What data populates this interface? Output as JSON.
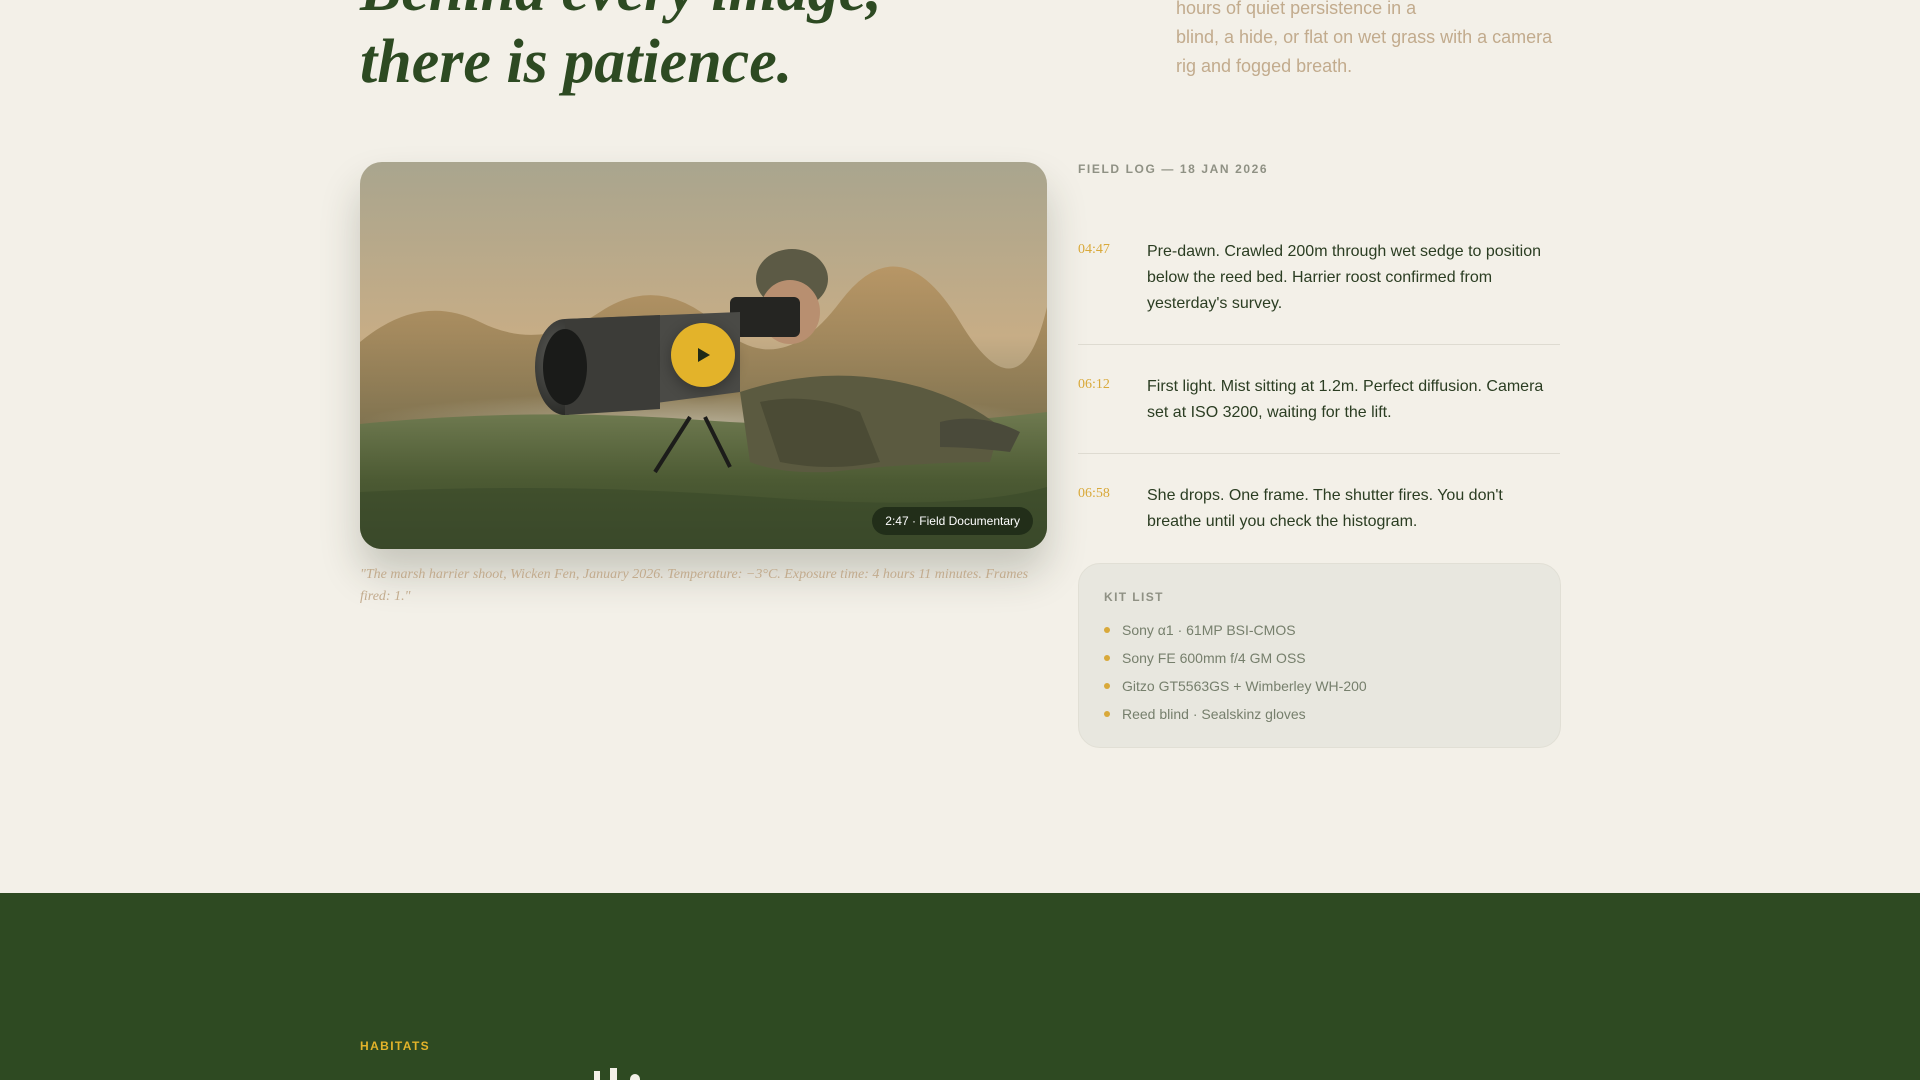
{
  "hero": {
    "heading_line1": "Behind every image,",
    "heading_line2": "there is patience.",
    "intro_line1": "hours of quiet persistence in a",
    "intro_line2": "blind, a hide, or flat on wet grass with a camera",
    "intro_line3": "rig and fogged breath."
  },
  "video": {
    "duration_label": "2:47 · Field Documentary",
    "play_icon": "play-icon",
    "caption": "\"The marsh harrier shoot, Wicken Fen, January 2026. Temperature: −3°C. Exposure time: 4 hours 11 minutes. Frames fired: 1.\""
  },
  "field_log": {
    "heading": "FIELD LOG — 18 JAN 2026",
    "entries": [
      {
        "time": "04:47",
        "line1": "Pre-dawn. Crawled 200m through wet sedge to position",
        "line2": "below the reed bed. Harrier roost confirmed from",
        "line3": "yesterday's survey."
      },
      {
        "time": "06:12",
        "line1": "First light. Mist sitting at 1.2m. Perfect diffusion. Camera",
        "line2": "set at ISO 3200, waiting for the lift."
      },
      {
        "time": "06:58",
        "line1": "She drops. One frame. The shutter fires. You don't",
        "line2": "breathe until you check the histogram."
      }
    ]
  },
  "kit": {
    "title": "KIT LIST",
    "items": [
      "Sony α1 · 61MP BSI-CMOS",
      "Sony FE 600mm f/4 GM OSS",
      "Gitzo GT5563GS + Wimberley WH-200",
      "Reed blind · Sealskinz gloves"
    ]
  },
  "habitats": {
    "label": "HABITATS"
  },
  "colors": {
    "background": "#f3f0e8",
    "forest_green": "#2e4a22",
    "accent_gold": "#e3b32a",
    "time_gold": "#d9a93a",
    "muted_tan": "#c2ab8d"
  }
}
